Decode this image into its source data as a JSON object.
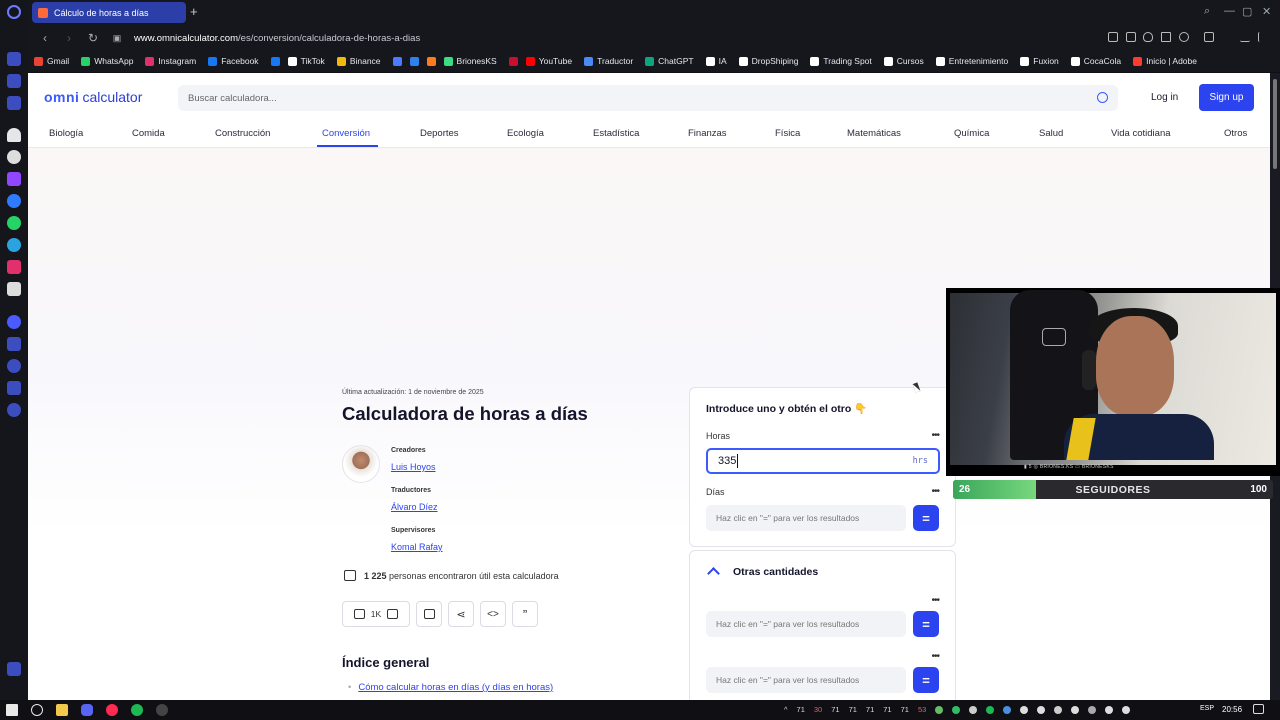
{
  "browser": {
    "tab_title": "Cálculo de horas a días",
    "new_tab": "+",
    "url_domain": "www.omnicalculator.com",
    "url_path": "/es/conversion/calculadora-de-horas-a-dias",
    "bookmarks": [
      "Gmail",
      "WhatsApp",
      "Instagram",
      "Facebook",
      "",
      "TikTok",
      "Binance",
      "",
      "",
      "",
      "BrionesKS",
      "",
      "YouTube",
      "Traductor",
      "ChatGPT",
      "IA",
      "DropShiping",
      "Trading Spot",
      "Cursos",
      "Entretenimiento",
      "Fuxion",
      "CocaCola",
      "Inicio | Adobe"
    ],
    "bookmark_colors": [
      "#ea4335",
      "#25d366",
      "#e1306c",
      "#1877f2",
      "#1877f2",
      "#ffffff",
      "#f0b90b",
      "#4a7cff",
      "#2f80ed",
      "#ff7a1a",
      "#3ddc84",
      "#c8102e",
      "#ff0000",
      "#4a8af4",
      "#10a37f",
      "#ffffff",
      "#ffffff",
      "#ffffff",
      "#ffffff",
      "#ffffff",
      "#ffffff",
      "#ffffff",
      "#ff3b30"
    ]
  },
  "site": {
    "logo_omni": "omni",
    "logo_calc": "calculator",
    "search_placeholder": "Buscar calculadora...",
    "login": "Log in",
    "signup": "Sign up",
    "categories": [
      "Biología",
      "Comida",
      "Construcción",
      "Conversión",
      "Deportes",
      "Ecología",
      "Estadística",
      "Finanzas",
      "Física",
      "Matemáticas",
      "Química",
      "Salud",
      "Vida cotidiana",
      "Otros"
    ],
    "active_category": "Conversión"
  },
  "article": {
    "updated": "Última actualización: 1 de noviembre de 2025",
    "title": "Calculadora de horas a días",
    "creators_label": "Creadores",
    "creator": "Luis Hoyos",
    "translators_label": "Traductores",
    "translator": "Álvaro Díez",
    "supervisors_label": "Supervisores",
    "supervisor": "Komal Rafay",
    "likes_count": "1 225",
    "likes_text": "personas encontraron útil esta calculadora",
    "like_button_count": "1K",
    "toc_title": "Índice general",
    "toc_first": "Cómo calcular horas en días (y días en horas)"
  },
  "calculator": {
    "title": "Introduce uno y obtén el otro 👇",
    "hours_label": "Horas",
    "hours_value": "335",
    "hours_unit": "hrs",
    "days_label": "Días",
    "result_placeholder": "Haz clic en \"=\" para ver los resultados",
    "eq": "=",
    "dots": "•••",
    "other_title": "Otras cantidades"
  },
  "stream": {
    "followers_current": "26",
    "followers_label": "SEGUIDORES",
    "followers_goal": "100",
    "followers_progress": 0.26,
    "cam_bar": "▮ 5    ◎ BRIONES.KS    ▭ BRIONESKS"
  },
  "taskbar": {
    "tray_numbers": [
      "71",
      "30",
      "71",
      "71",
      "71",
      "71",
      "71",
      "53"
    ],
    "lang": "ESP",
    "time": "20:56"
  }
}
